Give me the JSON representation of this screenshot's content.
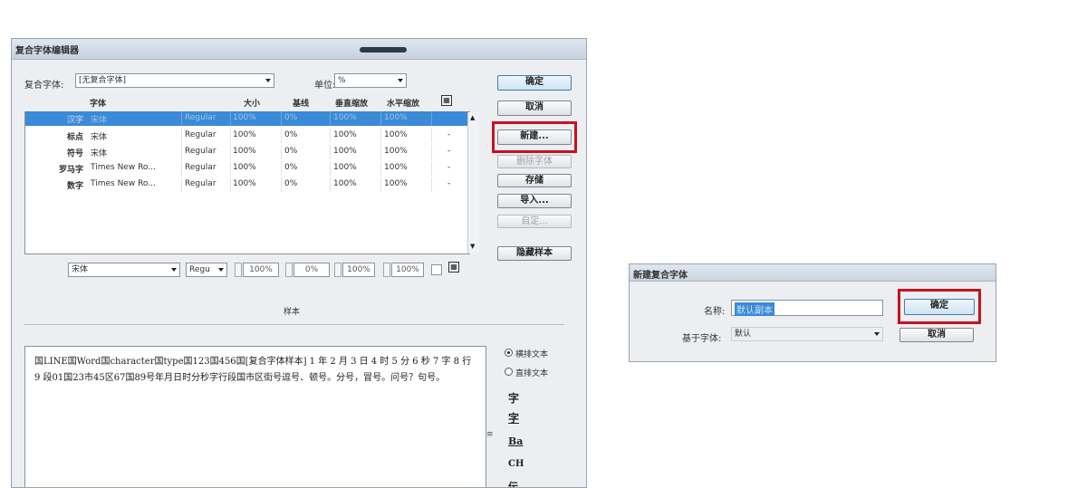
{
  "main_dialog": {
    "title": "复合字体编辑器",
    "composite_font_label": "复合字体:",
    "composite_font_value": "[无复合字体]",
    "unit_label": "单位:",
    "unit_value": "%",
    "buttons": {
      "ok": "确定",
      "cancel": "取消",
      "new": "新建...",
      "delete_font": "删除字体",
      "save": "存储",
      "import": "导入...",
      "custom": "自定...",
      "hide_sample": "隐藏样本"
    },
    "table": {
      "headers": [
        "字体",
        "大小",
        "基线",
        "垂直缩放",
        "水平缩放"
      ],
      "rows": [
        {
          "name": "汉字",
          "font": "宋体",
          "style": "Regular",
          "size": "100%",
          "baseline": "0%",
          "vscale": "100%",
          "hscale": "100%",
          "flag": "",
          "selected": true
        },
        {
          "name": "标点",
          "font": "宋体",
          "style": "Regular",
          "size": "100%",
          "baseline": "0%",
          "vscale": "100%",
          "hscale": "100%",
          "flag": "-",
          "selected": false
        },
        {
          "name": "符号",
          "font": "宋体",
          "style": "Regular",
          "size": "100%",
          "baseline": "0%",
          "vscale": "100%",
          "hscale": "100%",
          "flag": "-",
          "selected": false
        },
        {
          "name": "罗马字",
          "font": "Times New Ro...",
          "style": "Regular",
          "size": "100%",
          "baseline": "0%",
          "vscale": "100%",
          "hscale": "100%",
          "flag": "-",
          "selected": false
        },
        {
          "name": "数字",
          "font": "Times New Ro...",
          "style": "Regular",
          "size": "100%",
          "baseline": "0%",
          "vscale": "100%",
          "hscale": "100%",
          "flag": "-",
          "selected": false
        }
      ]
    },
    "edit_row": {
      "font": "宋体",
      "style": "Regu",
      "size": "100%",
      "baseline": "0%",
      "vscale": "100%",
      "hscale": "100%"
    },
    "sample_label": "样本",
    "sample_text": "国LINE国Word国character国type国123国456国[复合字体样本] 1 年 2 月 3 日 4 时 5 分 6 秒 7 字 8 行 9 段01国23市45区67国89号年月日时分秒字行段国市区街号逗号、顿号。分号，冒号。问号？句号。",
    "view_options": {
      "horizontal": "横排文本",
      "vertical": "直排文本"
    },
    "side_icons": [
      "字",
      "字",
      "Ba",
      "CH",
      "伝"
    ]
  },
  "new_dialog": {
    "title": "新建复合字体",
    "name_label": "名称:",
    "name_value": "默认副本",
    "based_on_label": "基于字体:",
    "based_on_value": "默认",
    "ok": "确定",
    "cancel": "取消"
  },
  "colors": {
    "highlight": "#c8121e",
    "selection": "#3b8ad7"
  }
}
